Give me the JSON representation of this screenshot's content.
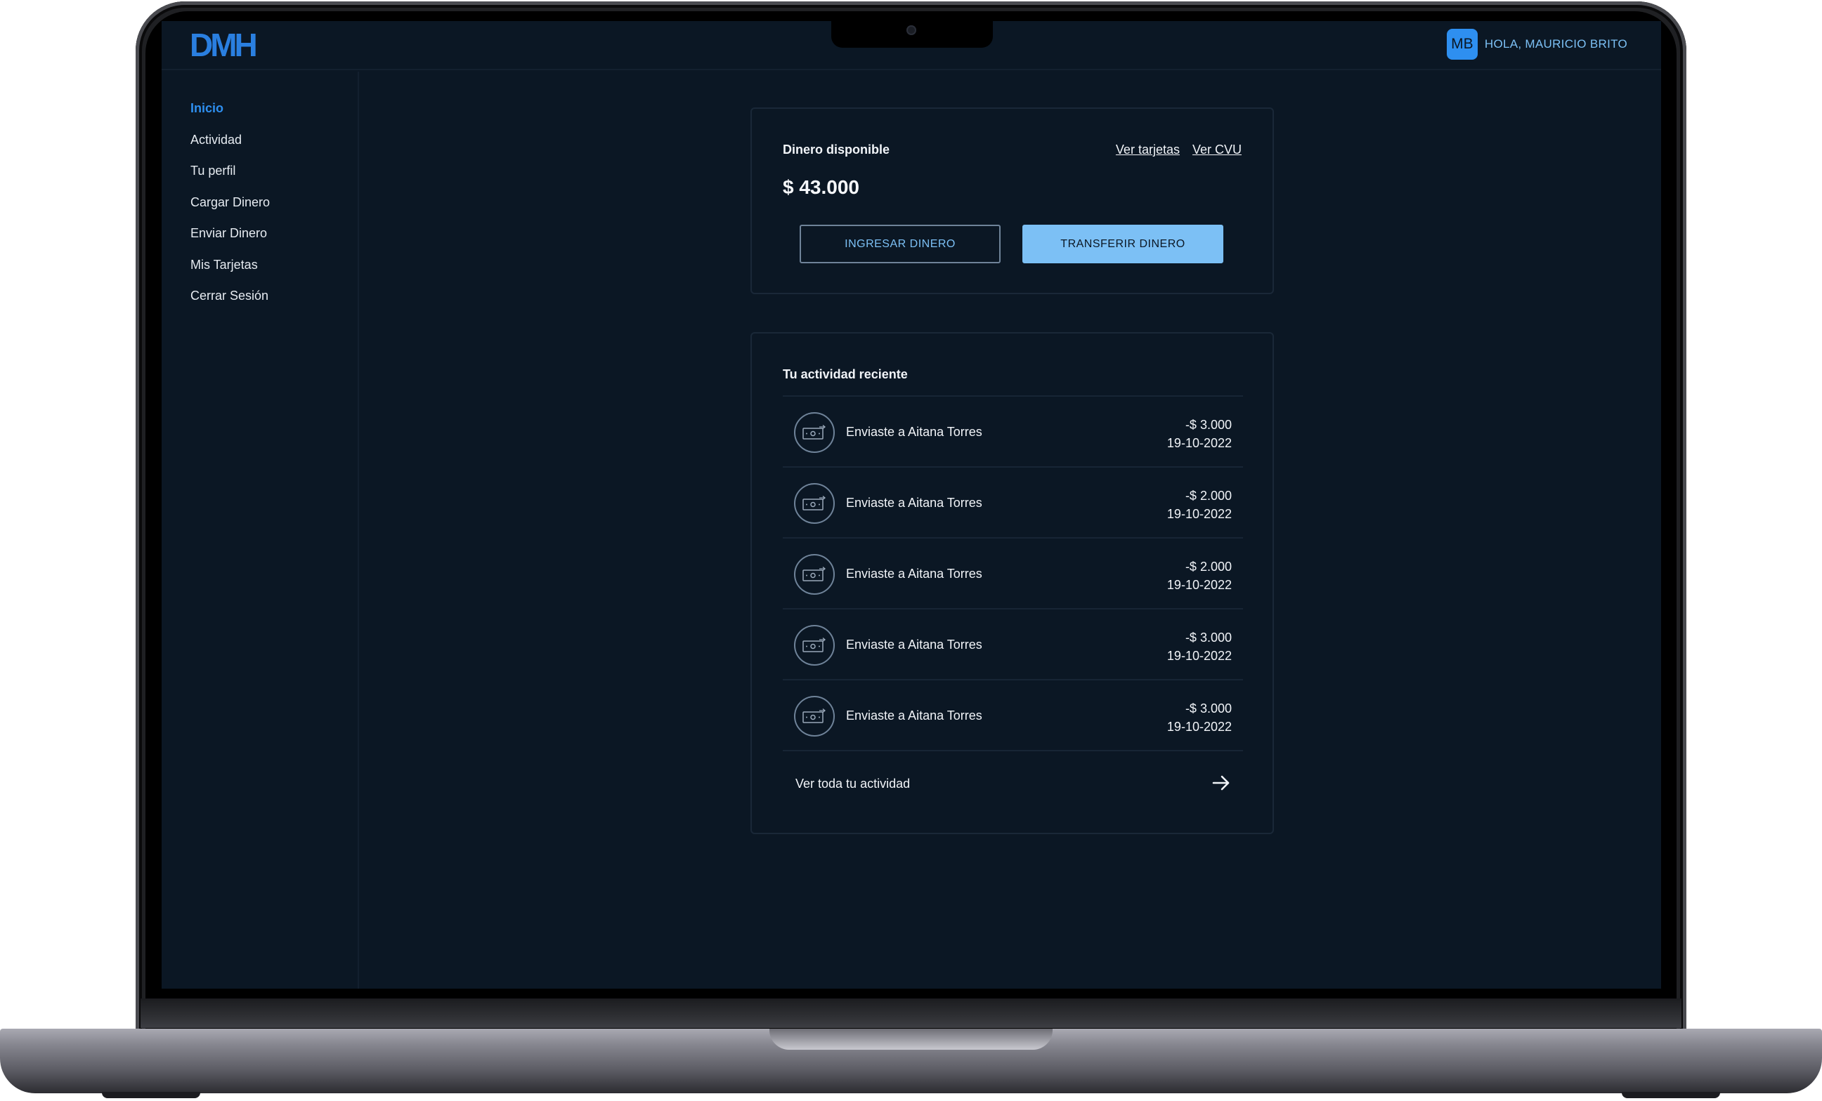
{
  "brand": {
    "logo_text": "DMH",
    "accent_color": "#2e8ff0",
    "accent_light": "#7cc0f5",
    "background": "#0b1724"
  },
  "header": {
    "avatar_initials": "MB",
    "greeting": "HOLA, MAURICIO BRITO"
  },
  "sidebar": {
    "items": [
      {
        "label": "Inicio",
        "active": true
      },
      {
        "label": "Actividad",
        "active": false
      },
      {
        "label": "Tu perfil",
        "active": false
      },
      {
        "label": "Cargar Dinero",
        "active": false
      },
      {
        "label": "Enviar Dinero",
        "active": false
      },
      {
        "label": "Mis Tarjetas",
        "active": false
      },
      {
        "label": "Cerrar Sesión",
        "active": false
      }
    ]
  },
  "balance": {
    "label": "Dinero disponible",
    "amount": "$ 43.000",
    "link_cards": "Ver tarjetas",
    "link_cvu": "Ver CVU",
    "btn_deposit": "INGRESAR DINERO",
    "btn_transfer": "TRANSFERIR DINERO"
  },
  "activity": {
    "title": "Tu actividad reciente",
    "items": [
      {
        "icon": "money-transfer-icon",
        "description": "Enviaste a Aitana Torres",
        "amount": "-$ 3.000",
        "date": "19-10-2022"
      },
      {
        "icon": "money-transfer-icon",
        "description": "Enviaste a Aitana Torres",
        "amount": "-$ 2.000",
        "date": "19-10-2022"
      },
      {
        "icon": "money-transfer-icon",
        "description": "Enviaste a Aitana Torres",
        "amount": "-$ 2.000",
        "date": "19-10-2022"
      },
      {
        "icon": "money-transfer-icon",
        "description": "Enviaste a Aitana Torres",
        "amount": "-$ 3.000",
        "date": "19-10-2022"
      },
      {
        "icon": "money-transfer-icon",
        "description": "Enviaste a Aitana Torres",
        "amount": "-$ 3.000",
        "date": "19-10-2022"
      }
    ],
    "see_all": "Ver toda tu actividad"
  }
}
